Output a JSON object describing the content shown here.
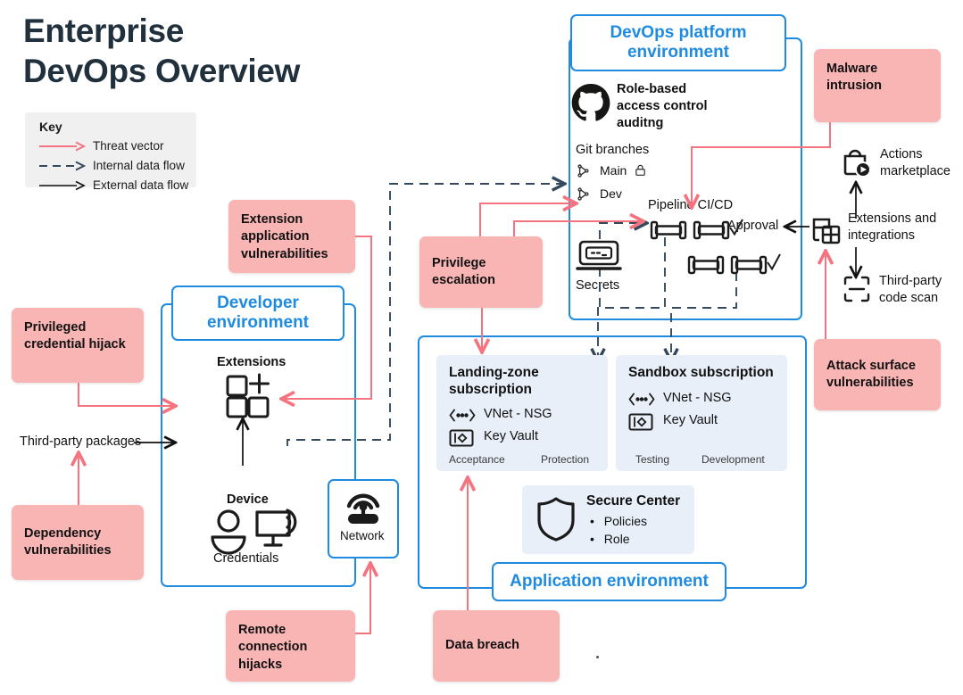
{
  "title": {
    "line1": "Enterprise",
    "line2": "DevOps Overview"
  },
  "key": {
    "heading": "Key",
    "items": [
      {
        "label": "Threat vector",
        "style": "solid",
        "color": "#f4737f"
      },
      {
        "label": "Internal data flow",
        "style": "dashed",
        "color": "#34495e"
      },
      {
        "label": "External data flow",
        "style": "solid",
        "color": "#111111"
      }
    ]
  },
  "colors": {
    "threat_fill": "#f9b4b4",
    "env_blue": "#1f8be0",
    "card_fill": "#e8eff9",
    "key_fill": "#f0f0f0",
    "threat_line": "#f4737f",
    "internal_line": "#34495e",
    "external_line": "#111111"
  },
  "environments": {
    "devops": {
      "label": "DevOps platform environment"
    },
    "developer": {
      "label": "Developer environment"
    },
    "application": {
      "label": "Application environment"
    }
  },
  "devops": {
    "rbac": {
      "label": "Role-based access control auditng",
      "icon": "github-icon"
    },
    "git": {
      "heading": "Git branches",
      "branches": [
        {
          "name": "Main",
          "locked": true,
          "icon": "branch-icon",
          "lock_icon": "lock-icon"
        },
        {
          "name": "Dev",
          "locked": false,
          "icon": "branch-icon"
        }
      ]
    },
    "pipeline": {
      "heading": "Pipeline CI/CD",
      "approval_label": "Approval",
      "stages_row1": 2,
      "stages_row2": 2
    },
    "secrets": {
      "label": "Secrets",
      "icon": "secrets-terminal-icon"
    }
  },
  "developer": {
    "extensions": {
      "label": "Extensions",
      "icon": "extensions-puzzle-icon"
    },
    "device": {
      "label": "Device",
      "icon": "monitor-wifi-icon"
    },
    "credentials": {
      "label": "Credentials",
      "icon": "user-icon"
    },
    "network": {
      "label": "Network",
      "icon": "network-antenna-icon"
    }
  },
  "application": {
    "landing_zone": {
      "title": "Landing-zone subscription",
      "rows": [
        {
          "label": "VNet - NSG",
          "icon": "vnet-icon"
        },
        {
          "label": "Key Vault",
          "icon": "key-vault-icon"
        }
      ],
      "footer": [
        "Acceptance",
        "Protection"
      ]
    },
    "sandbox": {
      "title": "Sandbox subscription",
      "rows": [
        {
          "label": "VNet - NSG",
          "icon": "vnet-icon"
        },
        {
          "label": "Key Vault",
          "icon": "key-vault-icon"
        }
      ],
      "footer": [
        "Testing",
        "Development"
      ]
    },
    "secure_center": {
      "title": "Secure Center",
      "icon": "shield-icon",
      "bullets": [
        "Policies",
        "Role"
      ]
    }
  },
  "integrations": {
    "actions_marketplace": {
      "label": "Actions marketplace",
      "icon": "marketplace-bag-icon"
    },
    "extensions_integrations": {
      "label": "Extensions and integrations",
      "icon": "extensions-grid-icon"
    },
    "third_party_scan": {
      "label": "Third-party code scan",
      "icon": "code-scan-icon"
    }
  },
  "flows": {
    "third_party_packages": "Third-party packages"
  },
  "threats": [
    {
      "id": "malware-intrusion",
      "label": "Malware intrusion"
    },
    {
      "id": "extension-application-vulnerabilities",
      "label": "Extension application vulnerabilities"
    },
    {
      "id": "privilege-escalation",
      "label": "Privilege escalation"
    },
    {
      "id": "privileged-credential-hijack",
      "label": "Privileged credential hijack"
    },
    {
      "id": "dependency-vulnerabilities",
      "label": "Dependency vulnerabilities"
    },
    {
      "id": "attack-surface-vulnerabilities",
      "label": "Attack surface vulnerabilities"
    },
    {
      "id": "remote-connection-hijacks",
      "label": "Remote connection hijacks"
    },
    {
      "id": "data-breach",
      "label": "Data breach"
    }
  ]
}
